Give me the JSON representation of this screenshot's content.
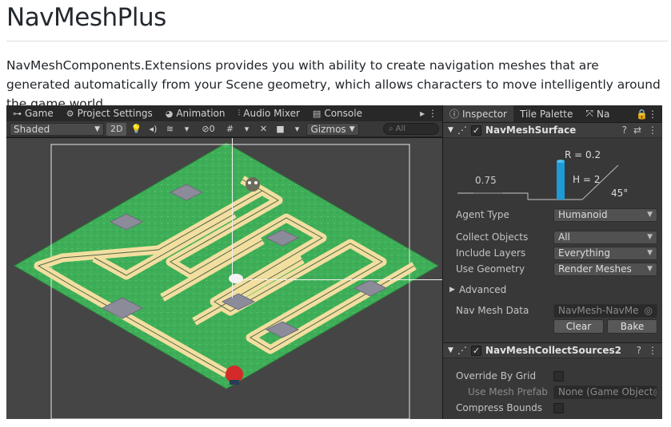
{
  "doc": {
    "title": "NavMeshPlus",
    "paragraph": "NavMeshComponents.Extensions provides you with ability to create navigation meshes that are generated automatically from your Scene geometry, which allows characters to move intelligently around the game world."
  },
  "editor": {
    "tabs": [
      {
        "label": "Game",
        "icon": "gamepad-icon"
      },
      {
        "label": "Project Settings",
        "icon": "gear-icon"
      },
      {
        "label": "Animation",
        "icon": "clock-icon"
      },
      {
        "label": "Audio Mixer",
        "icon": "mixer-icon"
      },
      {
        "label": "Console",
        "icon": "console-icon"
      }
    ],
    "toolbar": {
      "shading": "Shaded",
      "mode_2d": "2D",
      "hidden_count": "0",
      "gizmos": "Gizmos",
      "search_placeholder": "All"
    }
  },
  "inspector": {
    "tabs": [
      {
        "label": "Inspector",
        "icon": "info-icon"
      },
      {
        "label": "Tile Palette",
        "icon": ""
      },
      {
        "label": "Na",
        "icon": "navigation-icon"
      }
    ],
    "surface": {
      "title": "NavMeshSurface",
      "agent_diagram": {
        "radius": "R = 0.2",
        "height": "H = 2",
        "step": "0.75",
        "slope": "45°"
      },
      "agent_type_label": "Agent Type",
      "agent_type_value": "Humanoid",
      "collect_label": "Collect Objects",
      "collect_value": "All",
      "layers_label": "Include Layers",
      "layers_value": "Everything",
      "geometry_label": "Use Geometry",
      "geometry_value": "Render Meshes",
      "advanced_label": "Advanced",
      "data_label": "Nav Mesh Data",
      "data_value": "NavMesh-NavMe",
      "clear_label": "Clear",
      "bake_label": "Bake"
    },
    "collect": {
      "title": "NavMeshCollectSources2",
      "override_label": "Override By Grid",
      "prefab_label": "Use Mesh Prefab",
      "prefab_value": "None (Game Object",
      "compress_label": "Compress Bounds"
    }
  }
}
